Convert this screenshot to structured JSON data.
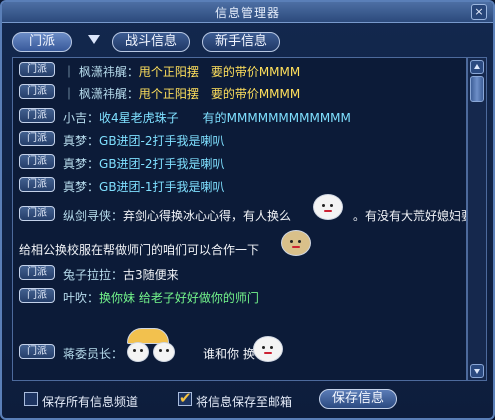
{
  "window": {
    "title": "信息管理器",
    "close_label": "×"
  },
  "tabs": {
    "channel": "门派",
    "battle": "战斗信息",
    "newbie": "新手信息"
  },
  "messages": [
    {
      "channel": "门派",
      "sender": "｜ 枫潇祎艉：",
      "text": "甩个正阳摆　要的带价MMMM",
      "color": "yellow"
    },
    {
      "channel": "门派",
      "sender": "｜ 枫潇祎艉：",
      "text": "甩个正阳摆　要的带价MMMM",
      "color": "yellow"
    },
    {
      "channel": "门派",
      "sender": "小吉：",
      "text": "收4星老虎珠子　　有的MMMMMMMMMMMM",
      "color": "cyan"
    },
    {
      "channel": "门派",
      "sender": "真梦：",
      "text": "GB进团-2打手我是喇叭",
      "color": "cyan"
    },
    {
      "channel": "门派",
      "sender": "真梦：",
      "text": "GB进团-2打手我是喇叭",
      "color": "cyan"
    },
    {
      "channel": "门派",
      "sender": "真梦：",
      "text": "GB进团-1打手我是喇叭",
      "color": "cyan"
    },
    {
      "channel": "门派",
      "sender": "纵剑寻侠：",
      "text": "弃剑心得换冰心心得，有人换么",
      "text_tail": "。有没有大荒好媳妇要",
      "color": "white"
    },
    {
      "channel": "",
      "sender": "",
      "text": "给相公换校服在帮做师门的咱们可以合作一下",
      "color": "white"
    },
    {
      "channel": "门派",
      "sender": "兔子拉拉：",
      "text": "古3随便来",
      "color": "white"
    },
    {
      "channel": "门派",
      "sender": "叶吹：",
      "text": "换你妹 给老子好好做你的师门",
      "color": "green"
    },
    {
      "channel": "门派",
      "sender": "蒋委员长：",
      "text": "谁和你 换",
      "color": "white"
    }
  ],
  "footer": {
    "save_all_label": "保存所有信息频道",
    "save_all_checked": false,
    "save_mail_label": "将信息保存至邮箱",
    "save_mail_checked": true,
    "save_button": "保存信息"
  },
  "icons": [
    "close-icon",
    "dropdown-arrow-icon",
    "scroll-up-icon",
    "scroll-down-icon",
    "emote-icon",
    "checkmark-icon"
  ]
}
